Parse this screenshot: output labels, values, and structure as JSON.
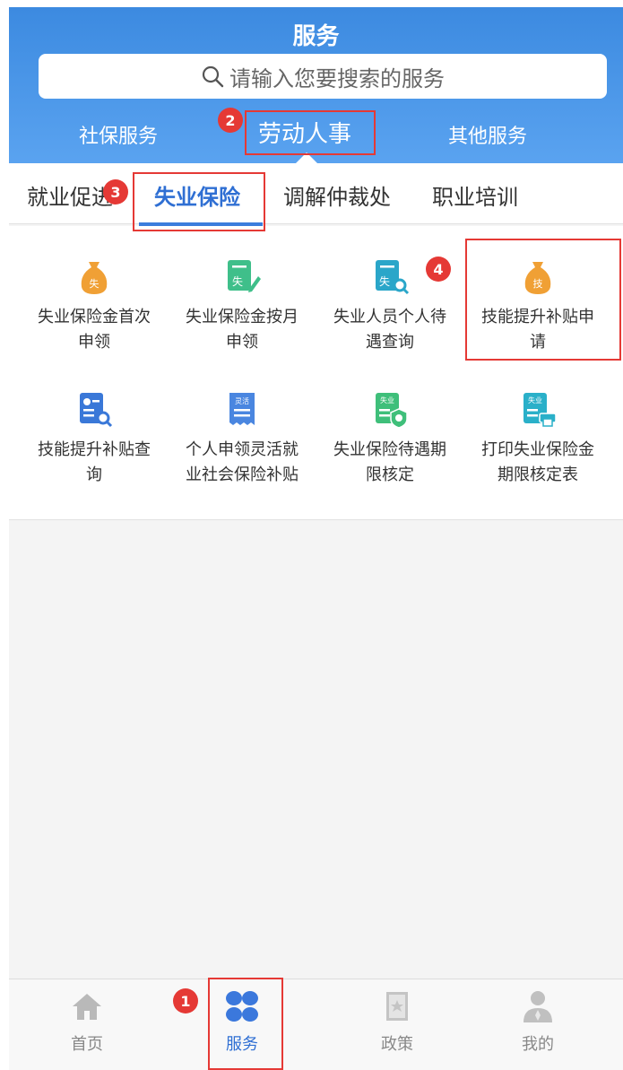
{
  "header": {
    "title": "服务",
    "search_placeholder": "请输入您要搜索的服务"
  },
  "top_tabs": [
    {
      "label": "社保服务"
    },
    {
      "label": "劳动人事"
    },
    {
      "label": "其他服务"
    }
  ],
  "sub_tabs": [
    {
      "label": "就业促进"
    },
    {
      "label": "失业保险"
    },
    {
      "label": "调解仲裁处"
    },
    {
      "label": "职业培训"
    }
  ],
  "services": [
    {
      "label": "失业保险金首次申领",
      "icon": "money-bag-icon",
      "glyph": "失",
      "color": "#f0a035"
    },
    {
      "label": "失业保险金按月申领",
      "icon": "form-edit-icon",
      "glyph": "失",
      "color": "#3fbf8a"
    },
    {
      "label": "失业人员个人待遇查询",
      "icon": "form-search-icon",
      "glyph": "失",
      "color": "#2aa6c9"
    },
    {
      "label": "技能提升补贴申请",
      "icon": "money-bag-icon",
      "glyph": "技",
      "color": "#f0a035"
    },
    {
      "label": "技能提升补贴查询",
      "icon": "id-card-search-icon",
      "glyph": "",
      "color": "#3a78d8"
    },
    {
      "label": "个人申领灵活就业社会保险补贴",
      "icon": "receipt-icon",
      "glyph": "灵活",
      "color": "#4a86e0"
    },
    {
      "label": "失业保险待遇期限核定",
      "icon": "shield-clock-icon",
      "glyph": "失业",
      "color": "#3fbf7a"
    },
    {
      "label": "打印失业保险金期限核定表",
      "icon": "printer-icon",
      "glyph": "失业",
      "color": "#2ab0c9"
    }
  ],
  "bottom_nav": [
    {
      "label": "首页",
      "icon": "home-icon"
    },
    {
      "label": "服务",
      "icon": "grid-icon"
    },
    {
      "label": "政策",
      "icon": "bookmark-icon"
    },
    {
      "label": "我的",
      "icon": "user-icon"
    }
  ],
  "annotations": [
    {
      "number": "1"
    },
    {
      "number": "2"
    },
    {
      "number": "3"
    },
    {
      "number": "4"
    }
  ],
  "colors": {
    "header_blue": "#4a96e8",
    "active_blue": "#2f6fd3",
    "annotation_red": "#e53935"
  }
}
